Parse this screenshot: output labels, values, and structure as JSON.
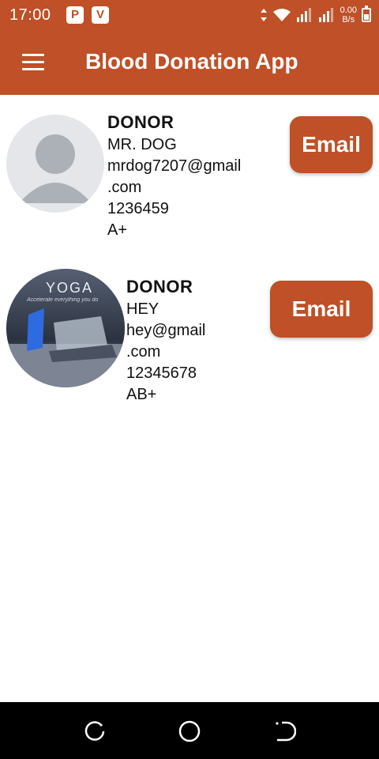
{
  "status_bar": {
    "time": "17:00",
    "app_icons": [
      "P",
      "V"
    ],
    "net_speed_value": "0.00",
    "net_speed_unit": "B/s"
  },
  "app_bar": {
    "menu_icon": "hamburger-menu-icon",
    "title": "Blood Donation App"
  },
  "donors": [
    {
      "role": "DONOR",
      "name": "MR. DOG",
      "email_line1": "mrdog7207@gmail",
      "email_line2": ".com",
      "phone": "1236459",
      "blood_group": "A+",
      "avatar": "default-avatar-icon",
      "button_label": "Email"
    },
    {
      "role": "DONOR",
      "name": "HEY",
      "email_line1": "hey@gmail",
      "email_line2": ".com",
      "phone": "12345678",
      "blood_group": "AB+",
      "avatar": "photo-avatar",
      "photo_text": "YOGA",
      "photo_caption": "Accelerate everything you do",
      "button_label": "Email"
    }
  ],
  "nav_bar": {
    "buttons": [
      "recent-apps-icon",
      "home-icon",
      "back-icon"
    ]
  },
  "colors": {
    "primary": "#BF5027",
    "navbar": "#000000",
    "text": "#111111"
  }
}
